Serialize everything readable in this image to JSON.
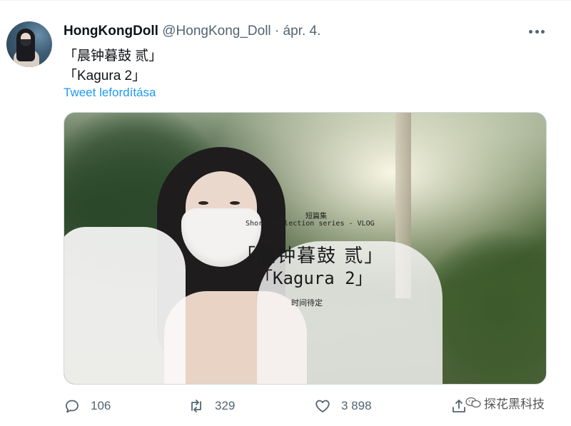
{
  "tweet": {
    "display_name": "HongKongDoll",
    "handle": "@HongKong_Doll",
    "separator": "·",
    "date": "ápr. 4.",
    "text_line1": "「晨钟暮鼓 贰」",
    "text_line2": "「Kagura 2」",
    "translate_link": "Tweet lefordítása"
  },
  "media": {
    "overlay_small": "短篇集",
    "overlay_series": "Short collection series - VLOG",
    "overlay_title": "「晨钟暮鼓 贰」",
    "overlay_kagura": "「Kagura 2」",
    "overlay_date": "时间待定"
  },
  "actions": {
    "reply_count": "106",
    "retweet_count": "329",
    "like_count": "3 898"
  },
  "watermark": {
    "text": "探花黑科技"
  },
  "icons": {
    "more": "more-icon",
    "reply": "reply-icon",
    "retweet": "retweet-icon",
    "like": "heart-icon",
    "share": "share-icon",
    "watermark": "wechat-icon"
  },
  "colors": {
    "link": "#1d9bf0",
    "muted": "#536471",
    "text": "#0f1419"
  }
}
